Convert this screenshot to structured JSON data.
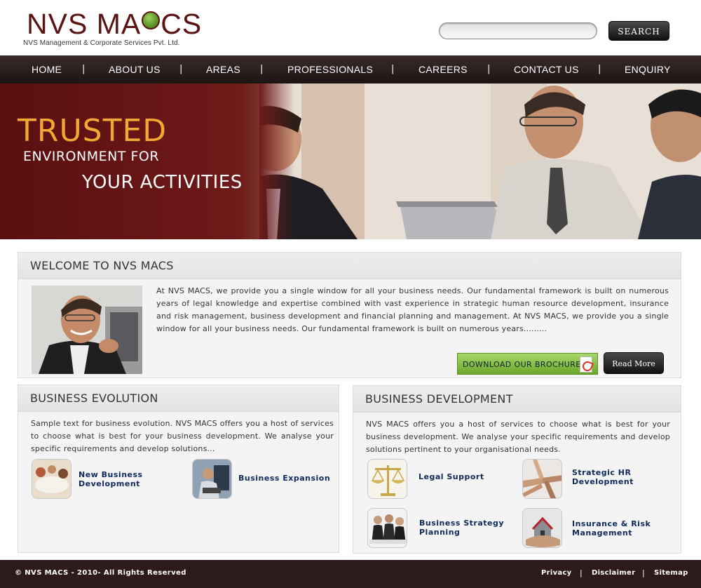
{
  "header": {
    "logo_title_a": "NVS MA",
    "logo_title_b": "CS",
    "logo_subtitle": "NVS Management & Corporate Services Pvt. Ltd.",
    "search_placeholder": "",
    "search_button": "SEARCH"
  },
  "nav": {
    "items": [
      "HOME",
      "ABOUT US",
      "AREAS",
      "PROFESSIONALS",
      "CAREERS",
      "CONTACT US",
      "ENQUIRY"
    ],
    "separator": "|"
  },
  "banner": {
    "line1": "TRUSTED",
    "line2": "ENVIRONMENT FOR",
    "line3": "YOUR ACTIVITIES"
  },
  "welcome": {
    "title": "WELCOME TO NVS MACS",
    "text": "At NVS MACS, we provide you a single window for all your business needs. Our fundamental framework is built on numerous years of legal knowledge and expertise combined with vast experience in strategic human resource development, insurance and risk management, business development and financial planning and management.  At NVS MACS, we provide you a single window for all your business needs. Our fundamental framework is built on numerous years.........",
    "brochure_button": "DOWNLOAD OUR BROCHURE",
    "read_more_button": "Read More"
  },
  "evolution": {
    "title": "BUSINESS EVOLUTION",
    "text": "Sample text for business evolution.  NVS MACS offers you a host of services to choose what is best for your business development. We analyse your specific requirements and develop solutions...",
    "items": [
      {
        "label_line1": "New Business",
        "label_line2": "Development"
      },
      {
        "label_line1": "Business Expansion",
        "label_line2": ""
      }
    ]
  },
  "development": {
    "title": "BUSINESS DEVELOPMENT",
    "text": "NVS MACS offers you a host of services to choose what is best for your business development.  We analyse your specific requirements and develop solutions pertinent to your organisational needs.",
    "items": [
      {
        "label_line1": "Legal Support",
        "label_line2": ""
      },
      {
        "label_line1": "Strategic HR",
        "label_line2": "Development"
      },
      {
        "label_line1": "Business Strategy",
        "label_line2": "Planning"
      },
      {
        "label_line1": "Insurance & Risk",
        "label_line2": "Management"
      }
    ]
  },
  "footer": {
    "copyright": "© NVS MACS - 2010- All Rights Reserved",
    "links": [
      "Privacy",
      "Disclaimer",
      "Sitemap"
    ],
    "separator": "|"
  },
  "colors": {
    "brand_maroon": "#5a1414",
    "banner_orange": "#f3a836",
    "nav_bg": "#2a1e1e",
    "link_navy": "#0e2a5a",
    "brochure_green": "#8cc34a"
  }
}
